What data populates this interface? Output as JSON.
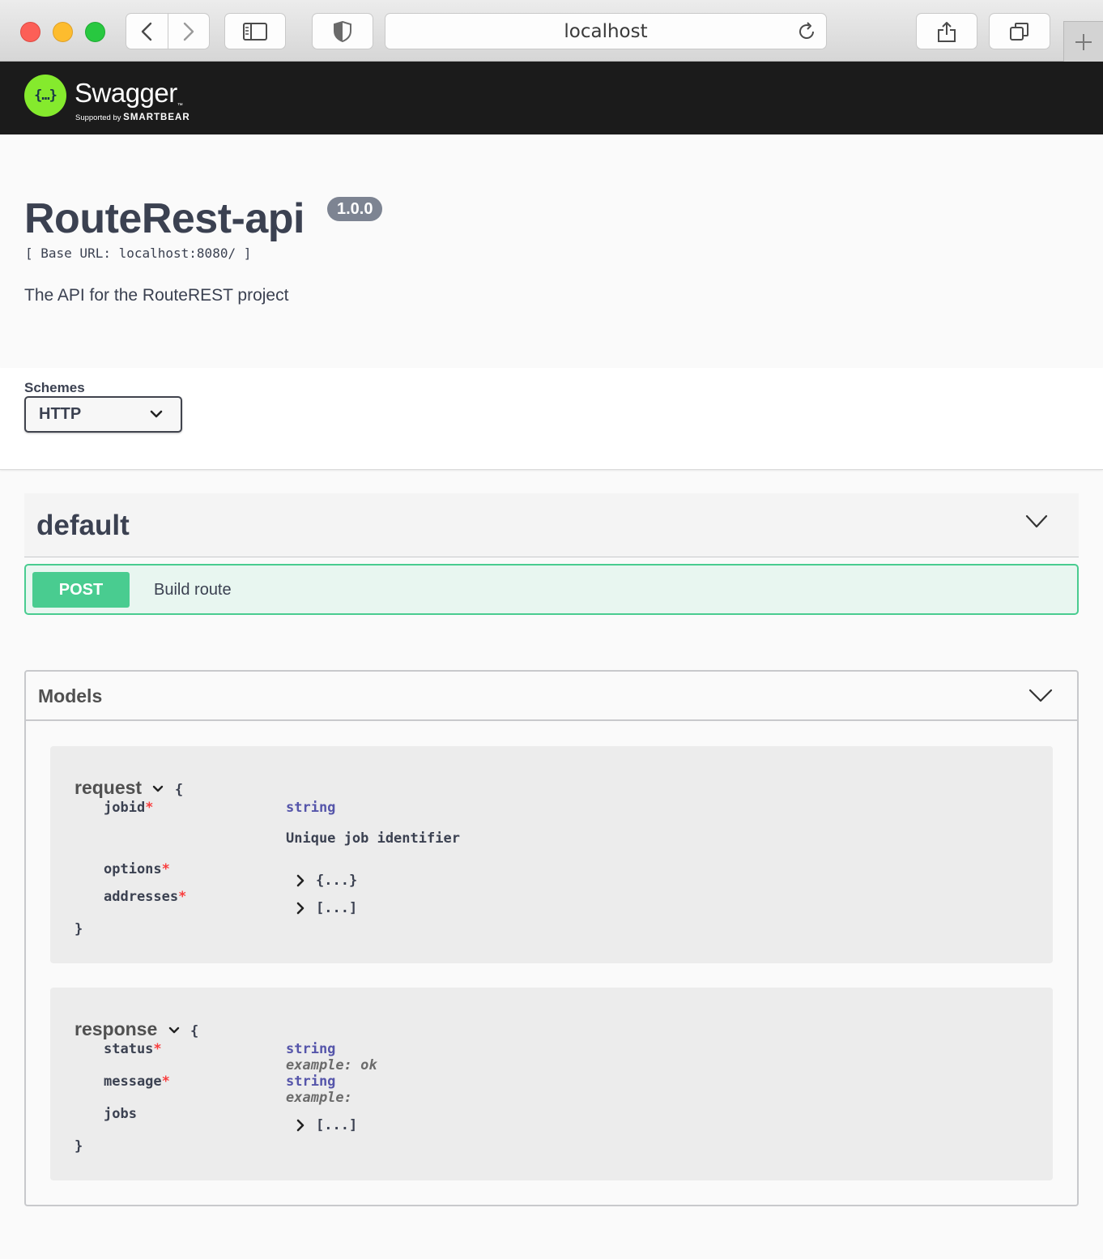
{
  "browser": {
    "url": "localhost",
    "controls": [
      "back",
      "forward",
      "sidebar",
      "privacy-shield",
      "share",
      "tabs-overview",
      "new-tab"
    ]
  },
  "topbar": {
    "brand": "Swagger",
    "tm": "™",
    "supported_prefix": "Supported by",
    "supported_by": "SMARTBEAR",
    "logo_glyph": "{…}"
  },
  "info": {
    "title": "RouteRest-api",
    "version": "1.0.0",
    "base_url": "[ Base URL: localhost:8080/ ]",
    "description": "The API for the RouteREST project"
  },
  "schemes": {
    "label": "Schemes",
    "selected": "HTTP"
  },
  "tag": {
    "name": "default",
    "operations": [
      {
        "method": "POST",
        "summary": "Build route"
      }
    ]
  },
  "models": {
    "title": "Models",
    "request": {
      "name": "request",
      "open_brace": "{",
      "close_brace": "}",
      "props": [
        {
          "name": "jobid",
          "required": "*",
          "type": "string",
          "description": "Unique job identifier"
        },
        {
          "name": "options",
          "required": "*",
          "collapsed": "{...}"
        },
        {
          "name": "addresses",
          "required": "*",
          "collapsed": "[...]"
        }
      ]
    },
    "response": {
      "name": "response",
      "open_brace": "{",
      "close_brace": "}",
      "props": [
        {
          "name": "status",
          "required": "*",
          "type": "string",
          "example": "example: ok"
        },
        {
          "name": "message",
          "required": "*",
          "type": "string",
          "example": "example:"
        },
        {
          "name": "jobs",
          "collapsed": "[...]"
        }
      ]
    }
  },
  "colors": {
    "post_green": "#49cc90",
    "post_bg": "#e8f6f0",
    "swagger_green": "#85ea2d",
    "topbar_bg": "#1b1b1b",
    "required_red": "#f93e3e",
    "type_purple": "#55a"
  }
}
